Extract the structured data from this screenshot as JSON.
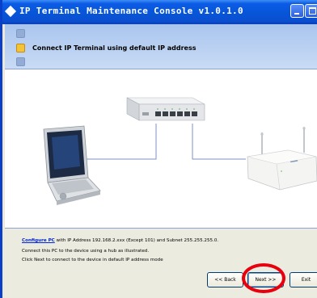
{
  "window": {
    "title": "IP Terminal Maintenance Console v1.0.1.0"
  },
  "steps": [
    {
      "label": "",
      "state": "done",
      "icon": "step-icon"
    },
    {
      "label": "Connect IP Terminal using default IP address",
      "state": "active",
      "icon": "folder-icon"
    },
    {
      "label": "",
      "state": "pending",
      "icon": "step-icon"
    }
  ],
  "diagram": {
    "devices": [
      "laptop-pc",
      "network-hub",
      "ip-terminal-device"
    ]
  },
  "info": {
    "link_text": "Configure PC",
    "line1_rest": " with IP Address 192.168.2.xxx (Except 101) and Subnet 255.255.255.0.",
    "line2": "Connect this PC to the device using a hub as illustrated.",
    "line3": "Click Next to connect to the device in default IP address mode"
  },
  "buttons": {
    "back": "<< Back",
    "next": "Next >>",
    "exit": "Exit"
  },
  "colors": {
    "titlebar": "#0756d9",
    "highlight_circle": "#e8000e",
    "link": "#0026d8"
  }
}
